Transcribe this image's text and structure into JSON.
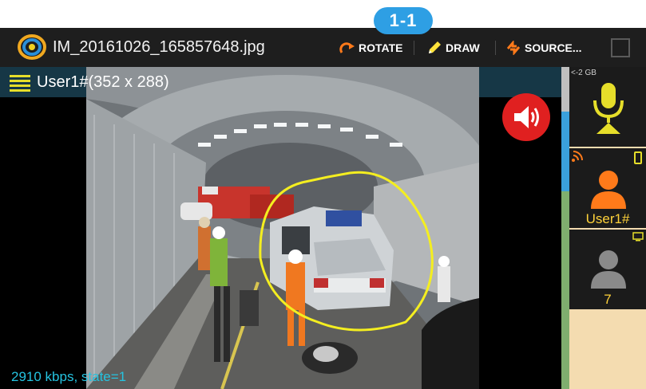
{
  "badge": {
    "label": "1-1"
  },
  "titlebar": {
    "file_name": "IM_20161026_165857648.jpg",
    "logo_icon": "app-logo-icon",
    "tools": {
      "rotate": "ROTATE",
      "draw": "DRAW",
      "source": "SOURCE..."
    },
    "expand_icon": "expand-icon"
  },
  "video": {
    "user_label": "User1#(352 x 288)",
    "status": "2910 kbps, state=1",
    "menu_icon": "hamburger-menu-icon",
    "speaker_icon": "speaker-volume-icon"
  },
  "panel": {
    "storage": "<-2 GB",
    "mic_icon": "microphone-icon",
    "user_name": "User1#",
    "other_count": "7"
  },
  "colors": {
    "badge": "#2e9fe4",
    "tool_accent": "#ff7a1a",
    "draw_accent": "#ffe23a",
    "mic": "#e6de2a",
    "user_avatar": "#ff7a1a",
    "other_avatar": "#8a8a8a",
    "speaker": "#e02020",
    "status_text": "#25c3e0",
    "panel_bg": "#f4dcb0"
  }
}
